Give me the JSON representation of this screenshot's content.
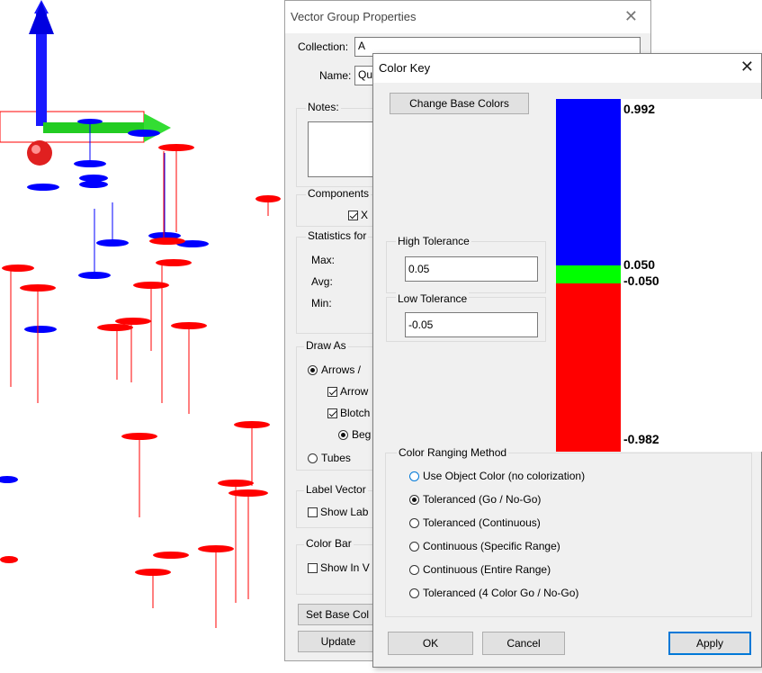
{
  "colors": {
    "blue": "#0000ff",
    "green": "#00ff00",
    "red": "#ff0000",
    "accent": "#0078d7"
  },
  "vgp": {
    "title": "Vector Group Properties",
    "collection_label": "Collection:",
    "collection_value": "A",
    "name_label": "Name:",
    "name_value": "Qu",
    "notes_label": "Notes:",
    "components_label": "Components",
    "components_x": "X",
    "stats_label": "Statistics for",
    "max_label": "Max:",
    "avg_label": "Avg:",
    "min_label": "Min:",
    "draw_as_label": "Draw As",
    "arrows_option": "Arrows /",
    "arrow_check": "Arrow",
    "blotch_check": "Blotch",
    "beg_option": "Beg",
    "tubes_option": "Tubes",
    "label_vectors_label": "Label Vector",
    "show_label_check": "Show Lab",
    "color_bar_label": "Color Bar",
    "show_in_check": "Show In V",
    "set_base_button": "Set Base Col",
    "update_button": "Update"
  },
  "color_key": {
    "title": "Color Key",
    "change_base_button": "Change Base Colors",
    "high_tolerance_label": "High Tolerance",
    "high_tolerance_value": "0.05",
    "low_tolerance_label": "Low Tolerance",
    "low_tolerance_value": "-0.05",
    "bar_values": {
      "top": "0.992",
      "high": "0.050",
      "low": "-0.050",
      "bottom": "-0.982"
    },
    "method_label": "Color Ranging Method",
    "methods": [
      {
        "label": "Use Object Color (no colorization)",
        "selected": false
      },
      {
        "label": "Toleranced (Go / No-Go)",
        "selected": true
      },
      {
        "label": "Toleranced (Continuous)",
        "selected": false
      },
      {
        "label": "Continuous (Specific Range)",
        "selected": false
      },
      {
        "label": "Continuous (Entire Range)",
        "selected": false
      },
      {
        "label": "Toleranced (4 Color Go / No-Go)",
        "selected": false
      }
    ],
    "ok_button": "OK",
    "cancel_button": "Cancel",
    "apply_button": "Apply"
  }
}
